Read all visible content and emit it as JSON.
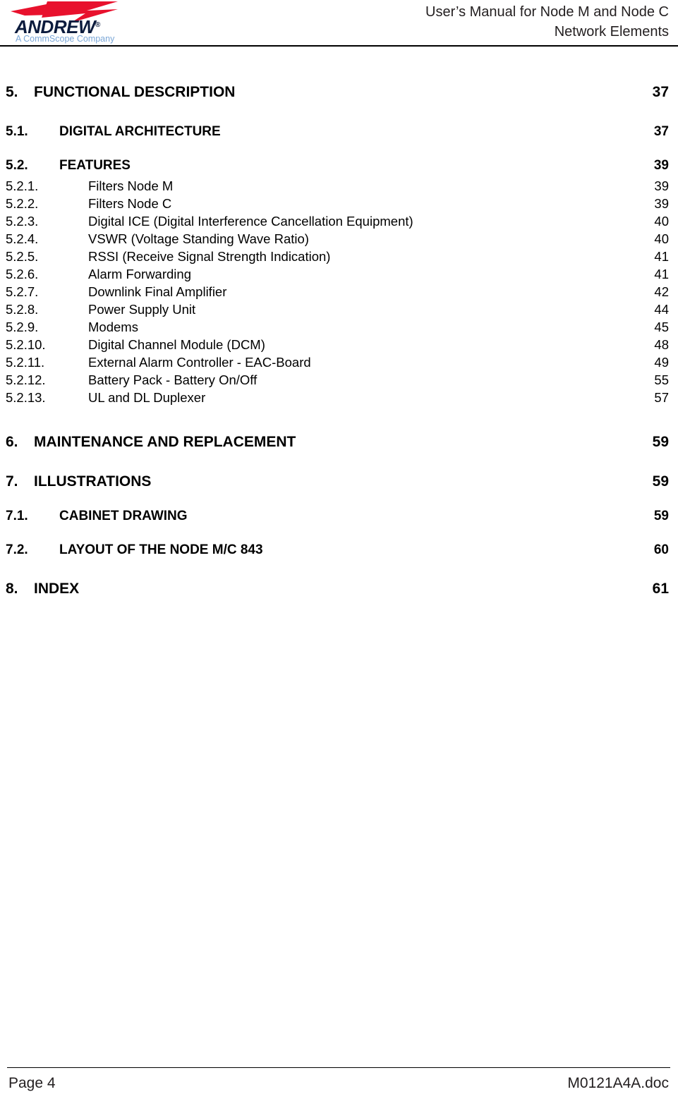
{
  "header": {
    "logo": {
      "wordmark": "ANDREW",
      "registered_mark": "®",
      "tagline": "A CommScope Company",
      "bolt_color": "#e8112d",
      "wordmark_color": "#0b1b3d",
      "tagline_color": "#7ba7d7"
    },
    "title_line1": "User’s Manual for Node M and Node C",
    "title_line2": "Network Elements"
  },
  "toc": {
    "entries": [
      {
        "level": 1,
        "number": "5.",
        "label": "FUNCTIONAL DESCRIPTION",
        "page": "37"
      },
      {
        "level": 2,
        "number": "5.1.",
        "label": "DIGITAL ARCHITECTURE",
        "page": "37"
      },
      {
        "level": 2,
        "number": "5.2.",
        "label": "FEATURES",
        "page": "39"
      },
      {
        "level": 3,
        "number": "5.2.1.",
        "label": "Filters Node M",
        "page": "39"
      },
      {
        "level": 3,
        "number": "5.2.2.",
        "label": "Filters Node C",
        "page": "39"
      },
      {
        "level": 3,
        "number": "5.2.3.",
        "label": "Digital ICE (Digital Interference Cancellation Equipment)",
        "page": "40"
      },
      {
        "level": 3,
        "number": "5.2.4.",
        "label": "VSWR (Voltage Standing Wave Ratio)",
        "page": "40"
      },
      {
        "level": 3,
        "number": "5.2.5.",
        "label": "RSSI (Receive Signal Strength Indication)",
        "page": "41"
      },
      {
        "level": 3,
        "number": "5.2.6.",
        "label": "Alarm Forwarding",
        "page": "41"
      },
      {
        "level": 3,
        "number": "5.2.7.",
        "label": "Downlink Final Amplifier",
        "page": "42"
      },
      {
        "level": 3,
        "number": "5.2.8.",
        "label": "Power Supply Unit",
        "page": "44"
      },
      {
        "level": 3,
        "number": "5.2.9.",
        "label": "Modems",
        "page": "45"
      },
      {
        "level": 3,
        "number": "5.2.10.",
        "label": "Digital Channel Module (DCM)",
        "page": "48"
      },
      {
        "level": 3,
        "number": "5.2.11.",
        "label": "External Alarm Controller - EAC-Board",
        "page": "49"
      },
      {
        "level": 3,
        "number": "5.2.12.",
        "label": "Battery Pack - Battery On/Off",
        "page": "55"
      },
      {
        "level": 3,
        "number": "5.2.13.",
        "label": "UL and DL Duplexer",
        "page": "57"
      },
      {
        "level": 1,
        "number": "6.",
        "label": "MAINTENANCE AND REPLACEMENT",
        "page": "59"
      },
      {
        "level": 1,
        "number": "7.",
        "label": "ILLUSTRATIONS",
        "page": "59"
      },
      {
        "level": 2,
        "number": "7.1.",
        "label": "CABINET DRAWING",
        "page": "59"
      },
      {
        "level": 2,
        "number": "7.2.",
        "label": "LAYOUT OF THE NODE M/C 843",
        "page": "60"
      },
      {
        "level": 1,
        "number": "8.",
        "label": "INDEX",
        "page": "61"
      }
    ]
  },
  "footer": {
    "page_label": "Page 4",
    "document_file": "M0121A4A.doc"
  }
}
